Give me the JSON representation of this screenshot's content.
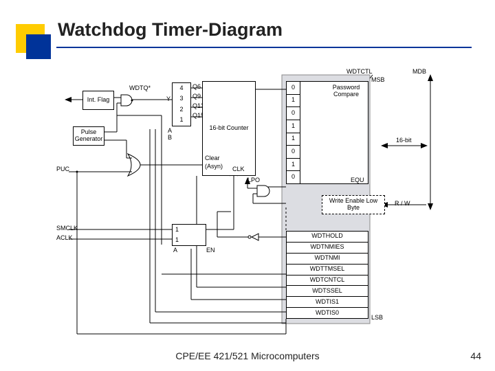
{
  "slide": {
    "title": "Watchdog Timer-Diagram",
    "footer_center": "CPE/EE 421/521 Microcomputers",
    "footer_page": "44"
  },
  "diagram": {
    "blocks": {
      "int_flag": "Int.\nFlag",
      "pulse_gen": "Pulse\nGenerator",
      "counter": "16-bit\nCounter",
      "pwd_compare": "Password\nCompare",
      "write_enable": "Write Enable\nLow Byte"
    },
    "signals": {
      "wdtq": "WDTQ*",
      "puc": "PUC",
      "wdtctl": "WDTCTL",
      "mdb": "MDB",
      "msb": "MSB",
      "lsb": "LSB",
      "bus_width": "16-bit",
      "rw": "R / W",
      "clear": "Clear",
      "asyn": "(Asyn)",
      "clk": "CLK",
      "lpo": "LPO",
      "en": "EN",
      "y0": "Y",
      "a": "A",
      "b": "B",
      "a2": "A",
      "smclk": "SMCLK",
      "aclk": "ACLK",
      "equ": "EQU"
    },
    "mux1": {
      "taps": [
        "Q6",
        "Q9",
        "Q13",
        "Q15"
      ],
      "sel": [
        "4",
        "3",
        "2",
        "1"
      ]
    },
    "clk_mux": {
      "sel": [
        "1",
        "1"
      ]
    },
    "pwd_bits": [
      "0",
      "1",
      "0",
      "1",
      "1",
      "0",
      "1",
      "0"
    ],
    "ctl_regs": [
      "WDTHOLD",
      "WDTNMIES",
      "WDTNMI",
      "WDTTMSEL",
      "WDTCNTCL",
      "WDTSSEL",
      "WDTIS1",
      "WDTIS0"
    ]
  }
}
